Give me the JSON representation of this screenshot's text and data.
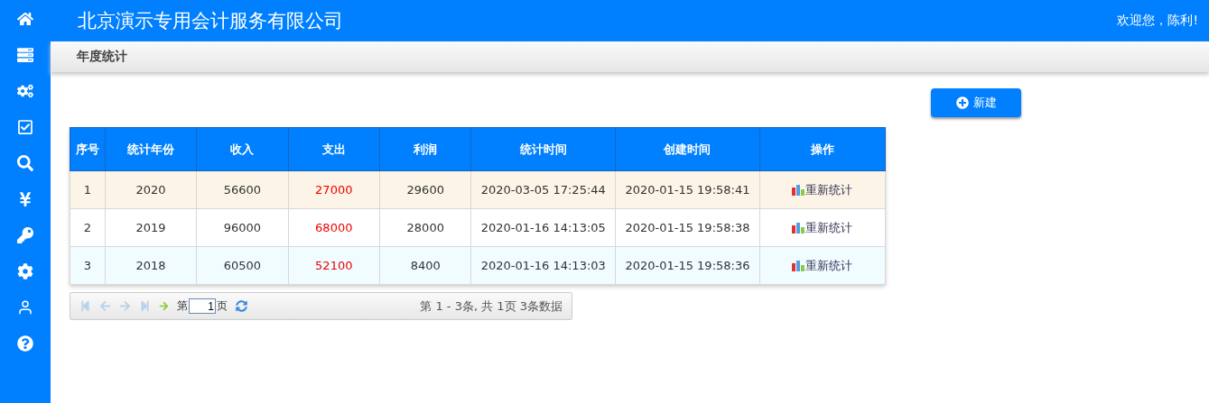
{
  "header": {
    "title": "北京演示专用会计服务有限公司",
    "welcome": "欢迎您，陈利!"
  },
  "breadcrumb": "年度统计",
  "new_button": "新建",
  "table": {
    "columns": [
      "序号",
      "统计年份",
      "收入",
      "支出",
      "利润",
      "统计时间",
      "创建时间",
      "操作"
    ],
    "rows": [
      {
        "selected": true,
        "cells": [
          "1",
          "2020",
          "56600",
          "27000",
          "29600",
          "2020-03-05 17:25:44",
          "2020-01-15 19:58:41"
        ],
        "action": "重新统计"
      },
      {
        "selected": false,
        "cells": [
          "2",
          "2019",
          "96000",
          "68000",
          "28000",
          "2020-01-16 14:13:05",
          "2020-01-15 19:58:38"
        ],
        "action": "重新统计"
      },
      {
        "selected": false,
        "cells": [
          "3",
          "2018",
          "60500",
          "52100",
          "8400",
          "2020-01-16 14:13:03",
          "2020-01-15 19:58:36"
        ],
        "action": "重新统计"
      }
    ]
  },
  "pager": {
    "nav": [
      {
        "kind": "first",
        "disabled": true
      },
      {
        "kind": "prev",
        "disabled": true
      },
      {
        "kind": "next",
        "disabled": true
      },
      {
        "kind": "last",
        "disabled": true
      }
    ],
    "page_prefix": "第",
    "page_value": "1",
    "page_suffix": "页",
    "info": "第 1 - 3条, 共 1页 3条数据"
  }
}
